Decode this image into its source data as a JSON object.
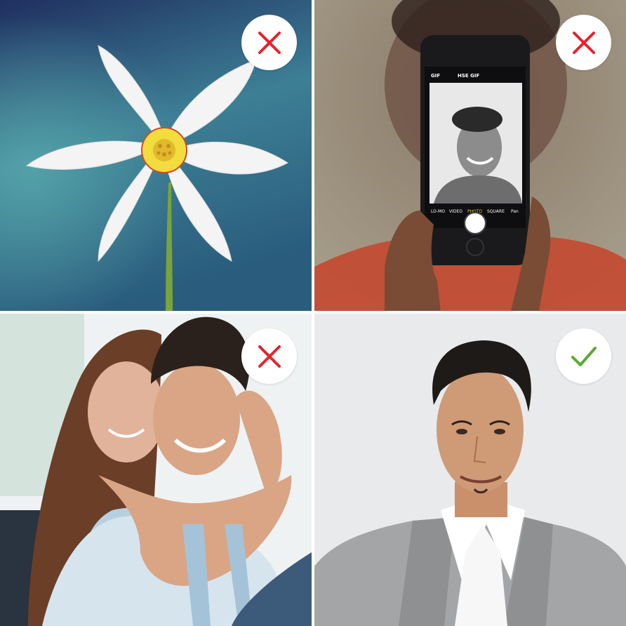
{
  "tiles": [
    {
      "subject": "white-flower",
      "verdict": "rejected",
      "verdict_icon": "cross-icon"
    },
    {
      "subject": "phone-selfie",
      "verdict": "rejected",
      "verdict_icon": "cross-icon"
    },
    {
      "subject": "couple-photo",
      "verdict": "rejected",
      "verdict_icon": "cross-icon"
    },
    {
      "subject": "headshot-portrait",
      "verdict": "accepted",
      "verdict_icon": "check-icon"
    }
  ],
  "phone_ui": {
    "top_bar": [
      "GIF",
      "HSE GIF"
    ],
    "modes": [
      "LO-MO",
      "VIDEO",
      "PHOTO",
      "SQUARE",
      "Pan"
    ]
  },
  "colors": {
    "cross": "#e8222b",
    "check": "#5aaa2e",
    "badge_bg": "#ffffff"
  }
}
